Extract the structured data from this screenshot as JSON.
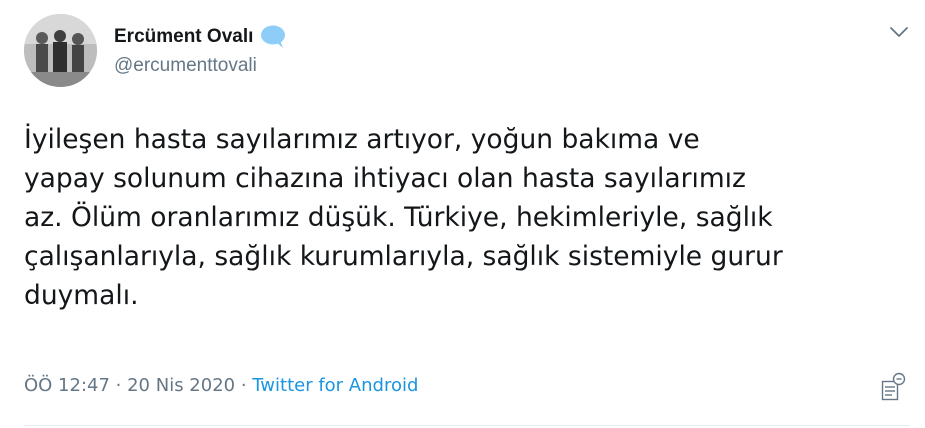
{
  "author": {
    "display_name": "Ercüment Ovalı",
    "handle": "@ercumenttovali",
    "verified_icon": "speech-bubble-badge-icon"
  },
  "tweet": {
    "text": "İyileşen hasta sayılarımız artıyor, yoğun bakıma ve\nyapay solunum cihazına ihtiyacı olan hasta sayılarımız\naz. Ölüm oranlarımız düşük. Türkiye, hekimleriyle, sağlık\nçalışanlarıyla, sağlık kurumlarıyla, sağlık sistemiyle gurur\nduymalı."
  },
  "meta": {
    "time": "ÖÖ 12:47",
    "separator_1": " · ",
    "date": "20 Nis 2020",
    "separator_2": " · ",
    "source": "Twitter for Android"
  },
  "colors": {
    "text": "#14171a",
    "secondary": "#657786",
    "link": "#1b95e0",
    "badge": "#8ecdf8",
    "divider": "#e6ecf0"
  }
}
